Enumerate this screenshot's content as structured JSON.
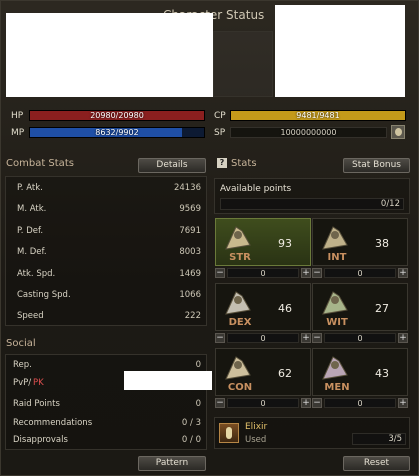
{
  "window": {
    "title": "Character Status"
  },
  "vitals": {
    "hp": {
      "label": "HP",
      "value": "20980/20980",
      "fill": 1.0,
      "color": "#8b1f1f"
    },
    "cp": {
      "label": "CP",
      "value": "9481/9481",
      "fill": 1.0,
      "color": "#c49a1a"
    },
    "mp": {
      "label": "MP",
      "value": "8632/9902",
      "fill": 0.872,
      "color": "#1f4fa6"
    },
    "sp": {
      "label": "SP",
      "value": "10000000000"
    }
  },
  "combat": {
    "title": "Combat Stats",
    "details_button": "Details",
    "rows": [
      {
        "label": "P. Atk.",
        "value": "24136"
      },
      {
        "label": "M. Atk.",
        "value": "9569"
      },
      {
        "label": "P. Def.",
        "value": "7691"
      },
      {
        "label": "M. Def.",
        "value": "8003"
      },
      {
        "label": "Atk. Spd.",
        "value": "1469"
      },
      {
        "label": "Casting Spd.",
        "value": "1066"
      },
      {
        "label": "Speed",
        "value": "222"
      }
    ]
  },
  "stats": {
    "title": "Stats",
    "bonus_button": "Stat Bonus",
    "available_label": "Available points",
    "available_value": "0/12",
    "tiles": [
      {
        "name": "STR",
        "value": "93",
        "pending": "0",
        "icon": "str-icon"
      },
      {
        "name": "INT",
        "value": "38",
        "pending": "0",
        "icon": "int-icon"
      },
      {
        "name": "DEX",
        "value": "46",
        "pending": "0",
        "icon": "dex-icon"
      },
      {
        "name": "WIT",
        "value": "27",
        "pending": "0",
        "icon": "wit-icon"
      },
      {
        "name": "CON",
        "value": "62",
        "pending": "0",
        "icon": "con-icon"
      },
      {
        "name": "MEN",
        "value": "43",
        "pending": "0",
        "icon": "men-icon"
      }
    ],
    "elixir": {
      "name": "Elixir",
      "used_label": "Used",
      "used_value": "3/5"
    },
    "reset_button": "Reset"
  },
  "social": {
    "title": "Social",
    "rows": [
      {
        "label": "Rep.",
        "value": "0"
      },
      {
        "label": "PvP/",
        "label_pk": "PK",
        "value": ""
      },
      {
        "label": "Raid Points",
        "value": "0"
      },
      {
        "label": "Recommendations",
        "value": "0 / 3"
      },
      {
        "label": "Disapprovals",
        "value": "0 / 0"
      }
    ],
    "pattern_button": "Pattern"
  }
}
